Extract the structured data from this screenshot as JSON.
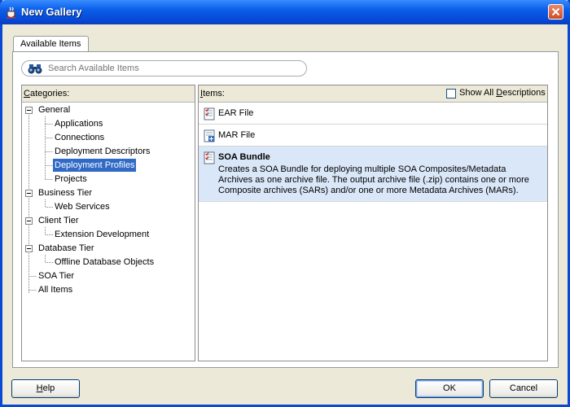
{
  "window": {
    "title": "New Gallery"
  },
  "tabs": [
    {
      "label": "Available Items",
      "active": true
    }
  ],
  "search": {
    "placeholder": "Search Available Items",
    "value": ""
  },
  "categories": {
    "header_prefix": "C",
    "header_rest": "ategories:",
    "nodes": [
      {
        "label": "General",
        "level": 0,
        "expanded": true
      },
      {
        "label": "Applications",
        "level": 1
      },
      {
        "label": "Connections",
        "level": 1
      },
      {
        "label": "Deployment Descriptors",
        "level": 1
      },
      {
        "label": "Deployment Profiles",
        "level": 1,
        "selected": true
      },
      {
        "label": "Projects",
        "level": 1
      },
      {
        "label": "Business Tier",
        "level": 0,
        "expanded": true
      },
      {
        "label": "Web Services",
        "level": 1
      },
      {
        "label": "Client Tier",
        "level": 0,
        "expanded": true
      },
      {
        "label": "Extension Development",
        "level": 1
      },
      {
        "label": "Database Tier",
        "level": 0,
        "expanded": true
      },
      {
        "label": "Offline Database Objects",
        "level": 1
      },
      {
        "label": "SOA Tier",
        "level": 0
      },
      {
        "label": "All Items",
        "level": 0
      }
    ]
  },
  "items": {
    "header_prefix": "I",
    "header_rest": "tems:",
    "show_all_prefix": "Show All ",
    "show_all_underlined": "D",
    "show_all_rest": "escriptions",
    "show_all_checked": false,
    "list": [
      {
        "name": "EAR File",
        "icon": "ear-file-icon"
      },
      {
        "name": "MAR File",
        "icon": "mar-file-icon"
      },
      {
        "name": "SOA Bundle",
        "icon": "soa-bundle-icon",
        "selected": true,
        "description_lines": [
          "Creates a SOA Bundle for deploying multiple SOA Composites/Metadata",
          "Archives as one archive file. The output archive file (.zip) contains one or more",
          "Composite archives (SARs) and/or one or more Metadata Archives (MARs)."
        ]
      }
    ]
  },
  "buttons": {
    "help_underlined": "H",
    "help_rest": "elp",
    "ok": "OK",
    "cancel": "Cancel"
  },
  "colors": {
    "selection": "#316ac5",
    "item_selection": "#d9e7f8",
    "titlebar": "#0a5ee8"
  }
}
